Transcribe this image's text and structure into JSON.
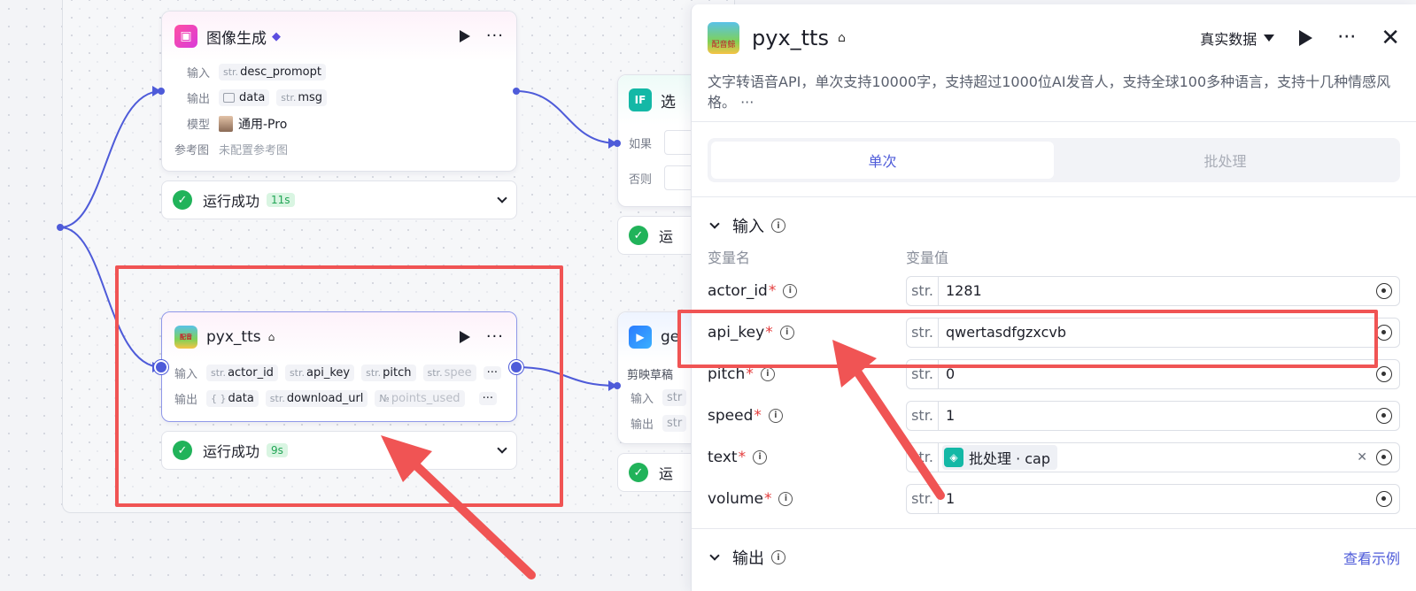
{
  "canvas": {
    "node_image": {
      "title": "图像生成",
      "input_label": "输入",
      "output_label": "输出",
      "model_label": "模型",
      "ref_label": "参考图",
      "input_vars": [
        {
          "type": "str.",
          "name": "desc_promopt"
        }
      ],
      "output_vars": [
        {
          "type": "img",
          "name": "data"
        },
        {
          "type": "str.",
          "name": "msg"
        }
      ],
      "model_value": "通用-Pro",
      "ref_value": "未配置参考图",
      "status": "运行成功",
      "duration": "11s"
    },
    "node_pyx": {
      "title": "pyx_tts",
      "input_label": "输入",
      "output_label": "输出",
      "input_vars": [
        {
          "type": "str.",
          "name": "actor_id"
        },
        {
          "type": "str.",
          "name": "api_key"
        },
        {
          "type": "str.",
          "name": "pitch"
        },
        {
          "type": "str.",
          "name": "spee"
        }
      ],
      "output_vars": [
        {
          "type": "{ }",
          "name": "data"
        },
        {
          "type": "str.",
          "name": "download_url"
        },
        {
          "type": "№",
          "name": "points_used"
        }
      ],
      "more": "···",
      "status": "运行成功",
      "duration": "9s"
    },
    "node_if": {
      "title": "选",
      "if_label": "如果",
      "else_label": "否则",
      "status": "运"
    },
    "node_ge": {
      "title": "ge",
      "subtitle": "剪映草稿",
      "input_label": "输入",
      "output_label": "输出",
      "type_hint": "str",
      "status": "运"
    }
  },
  "panel": {
    "title": "pyx_tts",
    "logo_text": "配音鲸",
    "mode": "真实数据",
    "description": "文字转语音API，单次支持10000字，支持超过1000位AI发音人，支持全球100多种语言，支持十几种情感风格。 ···",
    "tabs": [
      {
        "label": "单次",
        "active": true
      },
      {
        "label": "批处理",
        "active": false
      }
    ],
    "input_section": "输入",
    "col_name": "变量名",
    "col_value": "变量值",
    "inputs": [
      {
        "name": "actor_id",
        "type": "str.",
        "value": "1281"
      },
      {
        "name": "api_key",
        "type": "str.",
        "value": "qwertasdfgzxcvb"
      },
      {
        "name": "pitch",
        "type": "str.",
        "value": "0"
      },
      {
        "name": "speed",
        "type": "str.",
        "value": "1"
      },
      {
        "name": "text",
        "type": "str.",
        "ref": "批处理 · cap"
      },
      {
        "name": "volume",
        "type": "str.",
        "value": "1"
      }
    ],
    "required_mark": "*",
    "output_section": "输出",
    "view_example": "查看示例"
  },
  "colors": {
    "accent": "#4e5bd9",
    "success": "#21b35a",
    "annotation": "#f05454"
  }
}
